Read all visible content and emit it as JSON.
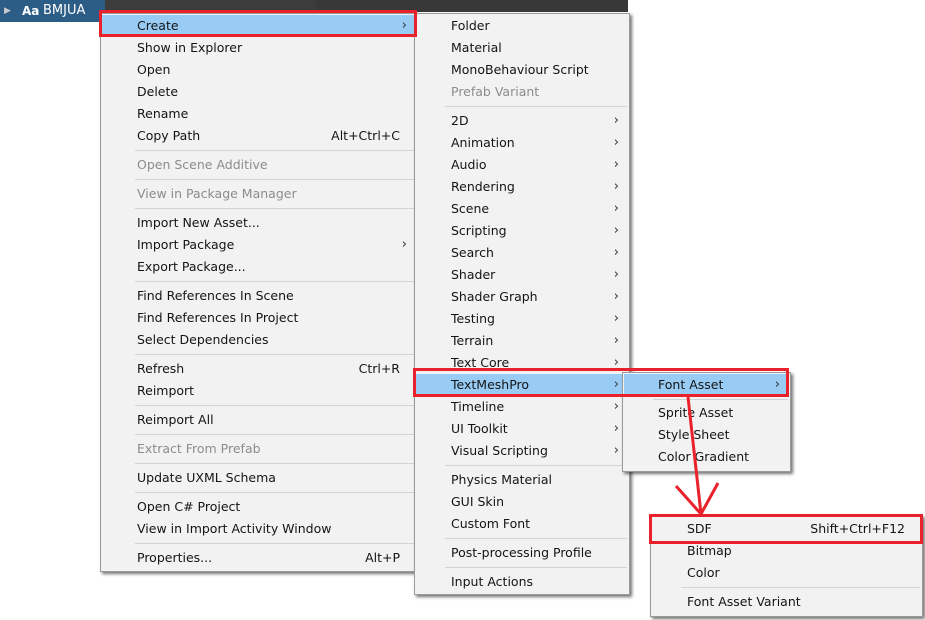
{
  "project_panel": {
    "asset_icon_text": "Aa",
    "asset_name": "BMJUA"
  },
  "main_menu": {
    "create": "Create",
    "show_in_explorer": "Show in Explorer",
    "open": "Open",
    "delete": "Delete",
    "rename": "Rename",
    "copy_path": "Copy Path",
    "copy_path_shortcut": "Alt+Ctrl+C",
    "open_scene_additive": "Open Scene Additive",
    "view_in_package_manager": "View in Package Manager",
    "import_new_asset": "Import New Asset...",
    "import_package": "Import Package",
    "export_package": "Export Package...",
    "find_references_in_scene": "Find References In Scene",
    "find_references_in_project": "Find References In Project",
    "select_dependencies": "Select Dependencies",
    "refresh": "Refresh",
    "refresh_shortcut": "Ctrl+R",
    "reimport": "Reimport",
    "reimport_all": "Reimport All",
    "extract_from_prefab": "Extract From Prefab",
    "update_uxml_schema": "Update UXML Schema",
    "open_csharp_project": "Open C# Project",
    "view_in_import_activity_window": "View in Import Activity Window",
    "properties": "Properties...",
    "properties_shortcut": "Alt+P"
  },
  "create_menu": {
    "folder": "Folder",
    "material": "Material",
    "monobehaviour_script": "MonoBehaviour Script",
    "prefab_variant": "Prefab Variant",
    "two_d": "2D",
    "animation": "Animation",
    "audio": "Audio",
    "rendering": "Rendering",
    "scene": "Scene",
    "scripting": "Scripting",
    "search": "Search",
    "shader": "Shader",
    "shader_graph": "Shader Graph",
    "testing": "Testing",
    "terrain": "Terrain",
    "text_core": "Text Core",
    "textmeshpro": "TextMeshPro",
    "timeline": "Timeline",
    "ui_toolkit": "UI Toolkit",
    "visual_scripting": "Visual Scripting",
    "physics_material": "Physics Material",
    "gui_skin": "GUI Skin",
    "custom_font": "Custom Font",
    "post_processing_profile": "Post-processing Profile",
    "input_actions": "Input Actions"
  },
  "tmp_menu": {
    "font_asset": "Font Asset",
    "sprite_asset": "Sprite Asset",
    "style_sheet": "Style Sheet",
    "color_gradient": "Color Gradient"
  },
  "font_asset_menu": {
    "sdf": "SDF",
    "sdf_shortcut": "Shift+Ctrl+F12",
    "bitmap": "Bitmap",
    "color": "Color",
    "font_asset_variant": "Font Asset Variant"
  },
  "glyphs": {
    "submenu_arrow": "›",
    "fold_arrow": "▶"
  },
  "colors": {
    "highlight": "#99ccf5",
    "annotation_red": "#e8212b",
    "selected_asset_row": "#2c5d87"
  }
}
